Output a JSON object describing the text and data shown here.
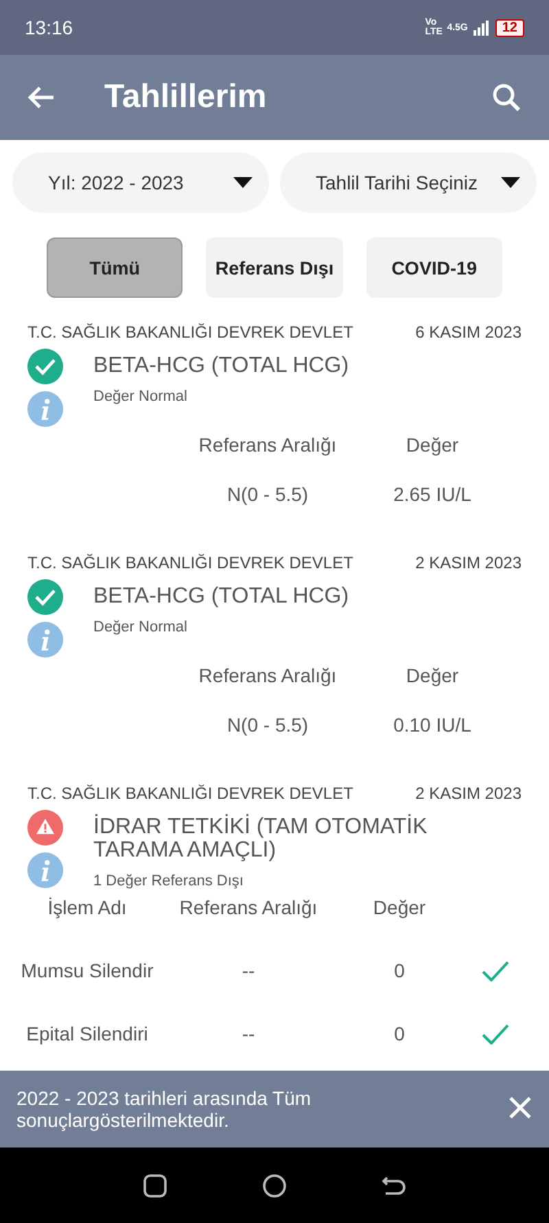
{
  "status_bar": {
    "time": "13:16",
    "network": "Vo LTE",
    "signal_label": "4.5G",
    "battery": "12"
  },
  "app_bar": {
    "title": "Tahlillerim"
  },
  "filters": [
    {
      "label": "Yıl: 2022 - 2023"
    },
    {
      "label": "Tahlil Tarihi Seçiniz"
    }
  ],
  "chips": [
    {
      "label": "Tümü",
      "selected": true
    },
    {
      "label": "Referans Dışı",
      "selected": false
    },
    {
      "label": "COVID-19",
      "selected": false
    }
  ],
  "results": [
    {
      "kind": "single",
      "out_of_range": false,
      "hospital": "T.C. SAĞLIK BAKANLIĞI DEVREK DEVLET",
      "date": "6 KASIM 2023",
      "title": "BETA-HCG (TOTAL HCG)",
      "note": "Değer Normal",
      "columns": [
        "Referans Aralığı",
        "Değer"
      ],
      "rows": [
        {
          "cells": [
            "N(0 - 5.5)",
            "2.65 IU/L"
          ]
        }
      ]
    },
    {
      "kind": "single",
      "out_of_range": false,
      "hospital": "T.C. SAĞLIK BAKANLIĞI DEVREK DEVLET",
      "date": "2 KASIM 2023",
      "title": "BETA-HCG (TOTAL HCG)",
      "note": "Değer Normal",
      "columns": [
        "Referans Aralığı",
        "Değer"
      ],
      "rows": [
        {
          "cells": [
            "N(0 - 5.5)",
            "0.10 IU/L"
          ]
        }
      ]
    },
    {
      "kind": "table",
      "out_of_range": true,
      "hospital": "T.C. SAĞLIK BAKANLIĞI DEVREK DEVLET",
      "date": "2 KASIM 2023",
      "title": "İDRAR TETKİKİ (TAM OTOMATİK TARAMA AMAÇLI)",
      "note": "1 Değer Referans Dışı",
      "columns": [
        "İşlem Adı",
        "Referans Aralığı",
        "Değer"
      ],
      "rows": [
        {
          "cells": [
            "Mumsu Silendir",
            "--",
            "0"
          ],
          "normal": true
        },
        {
          "cells": [
            "Epital Silendiri",
            "--",
            "0"
          ],
          "normal": true
        }
      ]
    }
  ],
  "snackbar": {
    "message": "2022 - 2023 tarihleri arasında Tüm sonuçlargösterilmektedir."
  }
}
